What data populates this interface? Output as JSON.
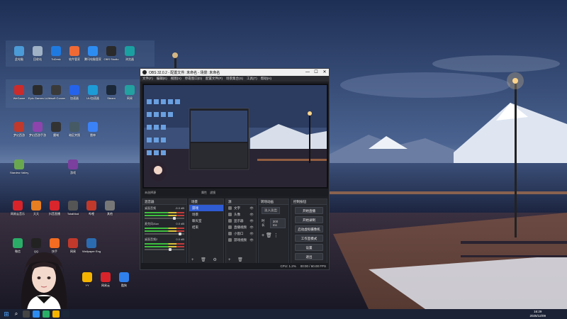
{
  "desktop": {
    "row1": [
      {
        "label": "此电脑",
        "icon": "pc-icon",
        "color": "#4b9bd8"
      },
      {
        "label": "回收站",
        "icon": "recycle-bin-icon",
        "color": "#9fb2c6"
      },
      {
        "label": "ToDesk",
        "icon": "todesk-icon",
        "color": "#1f7ae0"
      },
      {
        "label": "软件管家",
        "icon": "software-manager-icon",
        "color": "#f06a35"
      },
      {
        "label": "腾讯电脑管家",
        "icon": "tencent-pc-manager-icon",
        "color": "#2d8cf0"
      },
      {
        "label": "OBS Studio",
        "icon": "obs-icon",
        "color": "#2a2a2a"
      },
      {
        "label": "浏览器",
        "icon": "edge-icon",
        "color": "#1aa0a0"
      }
    ],
    "row2": [
      {
        "label": "WeGame",
        "icon": "wegame-icon",
        "color": "#cc2b2b"
      },
      {
        "label": "Epic Games Launcher",
        "icon": "epic-icon",
        "color": "#2b2b2b"
      },
      {
        "label": "Ubisoft Connect",
        "icon": "ubisoft-icon",
        "color": "#3a3a3a"
      },
      {
        "label": "加速器",
        "icon": "accelerator-icon",
        "color": "#2563eb"
      },
      {
        "label": "UU加速器",
        "icon": "uu-icon",
        "color": "#1d9bd6"
      },
      {
        "label": "Steam",
        "icon": "steam-icon",
        "color": "#1b2838"
      },
      {
        "label": "网易",
        "icon": "netease-icon",
        "color": "#23a0a0"
      }
    ],
    "row3": [
      {
        "label": "梦幻西游",
        "icon": "game1-icon",
        "color": "#c0392b"
      },
      {
        "label": "梦幻西游手游",
        "icon": "game2-icon",
        "color": "#8e44ad"
      },
      {
        "label": "魔域",
        "icon": "game3-icon",
        "color": "#333"
      },
      {
        "label": "暗区突围",
        "icon": "game4-icon",
        "color": "#455a64"
      },
      {
        "label": "雷神",
        "icon": "game5-icon",
        "color": "#3b82f6"
      }
    ],
    "row4": [
      {
        "label": "Stardew Valley",
        "icon": "stardew-icon",
        "color": "#6aa84f"
      },
      {
        "label": "游戏",
        "icon": "game6-icon",
        "color": "#7b3f9e"
      }
    ],
    "row5": [
      {
        "label": "网易云音乐",
        "icon": "netease-music-icon",
        "color": "#d8232a"
      },
      {
        "label": "天天",
        "icon": "app7-icon",
        "color": "#e67e22"
      },
      {
        "label": "抖音直播",
        "icon": "douyin-icon",
        "color": "#d9252c"
      },
      {
        "label": "TotalMod",
        "icon": "app8-icon",
        "color": "#555"
      },
      {
        "label": "哔哩",
        "icon": "app9-icon",
        "color": "#c0392b"
      },
      {
        "label": "其他",
        "icon": "app10-icon",
        "color": "#777"
      }
    ],
    "row6": [
      {
        "label": "微信",
        "icon": "wechat-icon",
        "color": "#2aae67"
      },
      {
        "label": "QQ",
        "icon": "qq-icon",
        "color": "#222"
      },
      {
        "label": "快手",
        "icon": "app11-icon",
        "color": "#f36c21"
      },
      {
        "label": "网易",
        "icon": "app12-icon",
        "color": "#c0392b"
      },
      {
        "label": "Wallpaper Engine",
        "icon": "wallpaper-engine-icon",
        "color": "#2b6cb0"
      }
    ],
    "row7": [
      {
        "label": "YY",
        "icon": "yy-icon",
        "color": "#f5b400"
      },
      {
        "label": "网易云",
        "icon": "app13-icon",
        "color": "#d8232a"
      },
      {
        "label": "酷狗",
        "icon": "kugou-icon",
        "color": "#2f80ed"
      }
    ]
  },
  "obs": {
    "title": "OBS 32.0.2 - 配置文件: 未命名 - 场景: 未命名",
    "menu": [
      "文件(F)",
      "编辑(E)",
      "视图(V)",
      "停靠窗口(D)",
      "配置文件(P)",
      "场景集合(S)",
      "工具(T)",
      "帮助(H)"
    ],
    "preview_label": "未选择源",
    "scene_toolbar": [
      "属性",
      "滤镜"
    ],
    "docks": {
      "mixer": {
        "title": "混音器",
        "tracks": [
          {
            "name": "桌面音频",
            "db": "-5.0 dB",
            "level": 0.72
          },
          {
            "name": "麦克风/Aux",
            "db": "0.0 dB",
            "level": 0.85
          },
          {
            "name": "桌面音频2",
            "db": "0.0 dB",
            "level": 0.6
          }
        ]
      },
      "scenes": {
        "title": "场景",
        "items": [
          "游戏",
          "场景",
          "聊天室",
          "结束"
        ],
        "active_index": 0
      },
      "sources": {
        "title": "源",
        "items": [
          "文字",
          "头像",
          "显示器",
          "直播视频",
          "小窗口",
          "游戏视频"
        ]
      },
      "transitions": {
        "title": "转场动画",
        "type": "淡入淡出",
        "duration_label": "时长",
        "duration": "300 ms"
      },
      "controls": {
        "title": "控制按钮",
        "buttons": [
          "开始直播",
          "开始录制",
          "启动虚拟摄像机",
          "工作室模式",
          "设置",
          "退出"
        ]
      }
    },
    "status": {
      "cpu": "CPU: 1.2%",
      "time": "00:00 / 60.00 FPS"
    }
  },
  "taskbar": {
    "time": "16:29",
    "date": "2025/12/09"
  }
}
